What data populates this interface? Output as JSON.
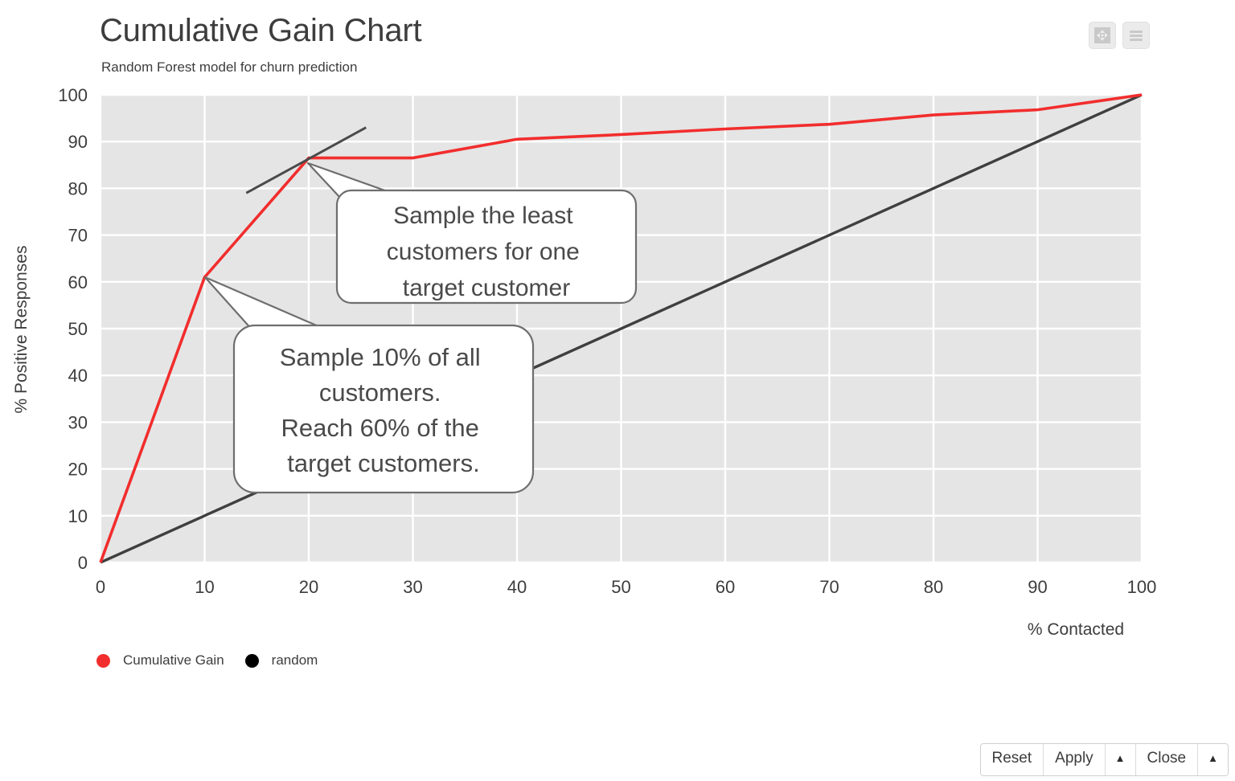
{
  "header": {
    "title": "Cumulative Gain Chart",
    "subtitle": "Random Forest model for churn prediction",
    "buttons": [
      {
        "name": "expand-button",
        "icon": "move-arrows-icon",
        "label": ""
      },
      {
        "name": "menu-button",
        "icon": "hamburger-icon",
        "label": ""
      }
    ]
  },
  "legend": [
    {
      "label": "Cumulative Gain",
      "color": "#f22d2d"
    },
    {
      "label": "random",
      "color": "#000000"
    }
  ],
  "annotations": [
    {
      "id": "callout-least-customers",
      "lines": [
        "Sample the least",
        "customers for one",
        "target customer"
      ],
      "points_to": {
        "x": 20,
        "y": 86.5
      }
    },
    {
      "id": "callout-sample-ten",
      "lines": [
        "Sample 10% of all",
        "customers.",
        "Reach 60% of the",
        "target customers."
      ],
      "points_to": {
        "x": 10,
        "y": 61
      }
    }
  ],
  "toolbar": {
    "reset_label": "Reset",
    "apply_label": "Apply",
    "apply_caret": "▲",
    "close_label": "Close",
    "close_caret": "▲"
  },
  "chart_data": {
    "type": "line",
    "title": "Cumulative Gain Chart",
    "subtitle": "Random Forest model for churn prediction",
    "xlabel": "% Contacted",
    "ylabel": "% Positive Responses",
    "xlim": [
      0,
      100
    ],
    "ylim": [
      0,
      100
    ],
    "xticks": [
      0,
      10,
      20,
      30,
      40,
      50,
      60,
      70,
      80,
      90,
      100
    ],
    "yticks": [
      0,
      10,
      20,
      30,
      40,
      50,
      60,
      70,
      80,
      90,
      100
    ],
    "grid": true,
    "legend_position": "bottom-left",
    "plot_background": "#e5e5e5",
    "gridline_color": "#ffffff",
    "series": [
      {
        "name": "Cumulative Gain",
        "color": "#f22d2d",
        "x": [
          0,
          10,
          20,
          30,
          40,
          50,
          60,
          70,
          80,
          90,
          100
        ],
        "values": [
          0,
          61,
          86.5,
          86.5,
          90.5,
          91.5,
          92.7,
          93.7,
          95.7,
          96.8,
          100
        ]
      },
      {
        "name": "random",
        "color": "#3f3f3f",
        "x": [
          0,
          100
        ],
        "values": [
          0,
          100
        ]
      }
    ],
    "tangent_marker": {
      "name": "slope-indicator",
      "color": "#4a4a4a",
      "from": {
        "x": 14,
        "y": 79
      },
      "to": {
        "x": 25.5,
        "y": 93
      }
    }
  }
}
